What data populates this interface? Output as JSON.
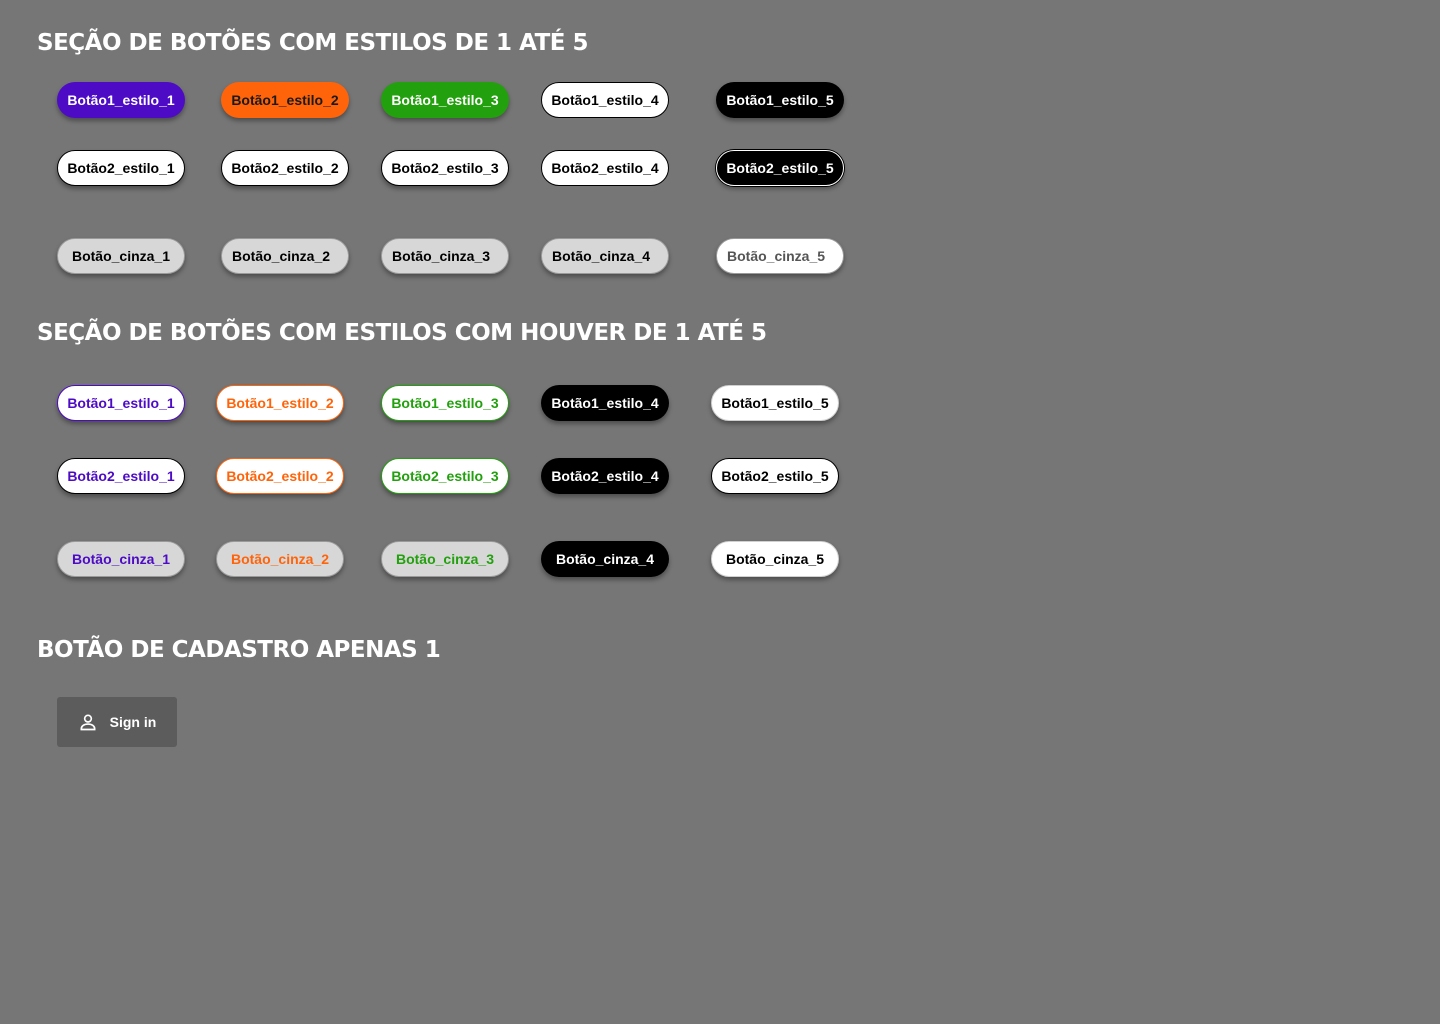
{
  "section1": {
    "title": "Seção de botões com estilos de 1 até 5",
    "row1": [
      "Botão1_estilo_1",
      "Botão1_estilo_2",
      "Botão1_estilo_3",
      "Botão1_estilo_4",
      "Botão1_estilo_5"
    ],
    "row2": [
      "Botão2_estilo_1",
      "Botão2_estilo_2",
      "Botão2_estilo_3",
      "Botão2_estilo_4",
      "Botão2_estilo_5"
    ],
    "row3": [
      "Botão_cinza_1",
      "Botão_cinza_2",
      "Botão_cinza_3",
      "Botão_cinza_4",
      "Botão_cinza_5"
    ]
  },
  "section2": {
    "title": "Seção de botões com estilos com houver de 1 até 5",
    "row1": [
      "Botão1_estilo_1",
      "Botão1_estilo_2",
      "Botão1_estilo_3",
      "Botão1_estilo_4",
      "Botão1_estilo_5"
    ],
    "row2": [
      "Botão2_estilo_1",
      "Botão2_estilo_2",
      "Botão2_estilo_3",
      "Botão2_estilo_4",
      "Botão2_estilo_5"
    ],
    "row3": [
      "Botão_cinza_1",
      "Botão_cinza_2",
      "Botão_cinza_3",
      "Botão_cinza_4",
      "Botão_cinza_5"
    ]
  },
  "section3": {
    "title": "Botão de cadastro apenas 1",
    "signin_label": "Sign in",
    "signin_icon": "person-icon"
  },
  "colors": {
    "background": "#767676",
    "purple": "#4d0bc6",
    "orange": "#ff640a",
    "green": "#22a00d",
    "black": "#000000",
    "white": "#ffffff",
    "gray": "#d7d7d7",
    "signin_bg": "#5c5c5c"
  }
}
